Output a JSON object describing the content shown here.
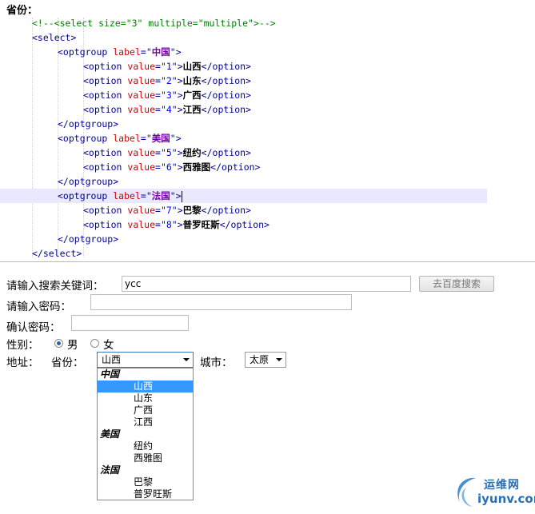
{
  "editor": {
    "title": "省份：",
    "lines": [
      {
        "kind": "comment",
        "text": "<!--<select size=\"3\" multiple=\"multiple\">-->"
      },
      {
        "kind": "open",
        "tag": "select"
      },
      {
        "kind": "group_open",
        "label": "中国"
      },
      {
        "kind": "option",
        "value": "1",
        "text": "山西"
      },
      {
        "kind": "option",
        "value": "2",
        "text": "山东"
      },
      {
        "kind": "option",
        "value": "3",
        "text": "广西"
      },
      {
        "kind": "option",
        "value": "4",
        "text": "江西"
      },
      {
        "kind": "group_close"
      },
      {
        "kind": "group_open",
        "label": "美国"
      },
      {
        "kind": "option",
        "value": "5",
        "text": "纽约"
      },
      {
        "kind": "option",
        "value": "6",
        "text": "西雅图"
      },
      {
        "kind": "group_close"
      },
      {
        "kind": "group_open",
        "label": "法国",
        "active": true
      },
      {
        "kind": "option",
        "value": "7",
        "text": "巴黎"
      },
      {
        "kind": "option",
        "value": "8",
        "text": "普罗旺斯"
      },
      {
        "kind": "group_close"
      },
      {
        "kind": "close",
        "tag": "select"
      }
    ]
  },
  "form": {
    "search_label": "请输入搜索关键词：",
    "search_value": "ycc",
    "search_button": "去百度搜索",
    "password_label": "请输入密码：",
    "confirm_label": "确认密码：",
    "gender_label": "性别：",
    "gender_male": "男",
    "gender_female": "女",
    "address_label": "地址：",
    "province_label": "省份：",
    "province_selected": "山西",
    "city_label": "城市：",
    "city_selected": "太原",
    "dropdown": [
      {
        "type": "group",
        "text": "中国"
      },
      {
        "type": "option",
        "text": "山西",
        "selected": true
      },
      {
        "type": "option",
        "text": "山东"
      },
      {
        "type": "option",
        "text": "广西"
      },
      {
        "type": "option",
        "text": "江西"
      },
      {
        "type": "group",
        "text": "美国"
      },
      {
        "type": "option",
        "text": "纽约"
      },
      {
        "type": "option",
        "text": "西雅图"
      },
      {
        "type": "group",
        "text": "法国"
      },
      {
        "type": "option",
        "text": "巴黎"
      },
      {
        "type": "option",
        "text": "普罗旺斯"
      }
    ]
  },
  "watermark": {
    "top": "运维网",
    "bottom": "iyunv.com",
    "logo_icon": "swoosh-logo-icon",
    "color": "#2a6fb5"
  }
}
